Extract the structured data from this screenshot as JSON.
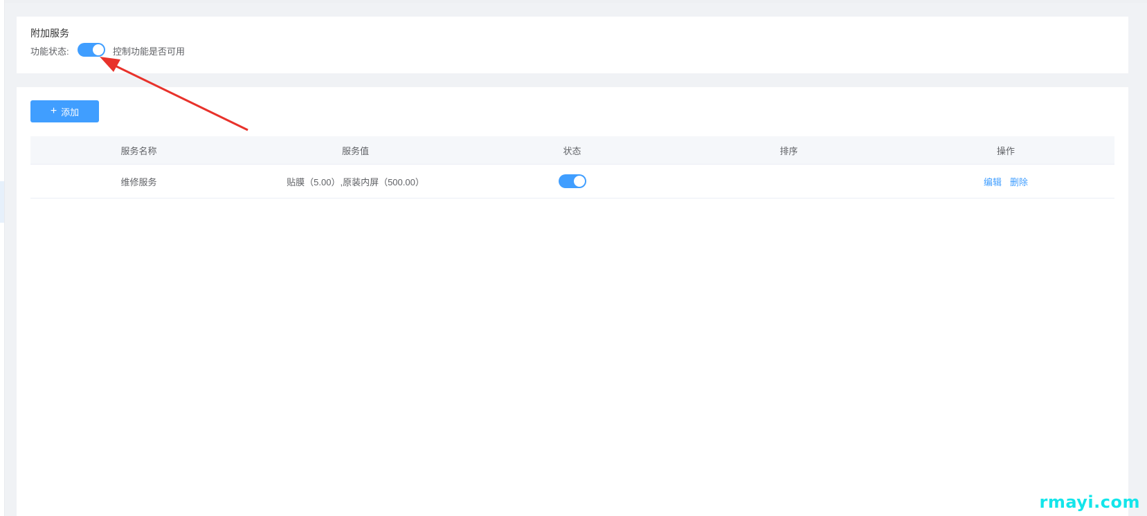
{
  "header": {
    "title": "附加服务",
    "status_label": "功能状态:",
    "status_enabled": true,
    "status_description": "控制功能是否可用"
  },
  "toolbar": {
    "add_label": "添加",
    "add_icon": "plus-icon"
  },
  "table": {
    "columns": [
      "服务名称",
      "服务值",
      "状态",
      "排序",
      "操作"
    ],
    "rows": [
      {
        "name": "维修服务",
        "value": "贴膜（5.00）,原装内屏（500.00）",
        "enabled": true,
        "sort": "",
        "actions": [
          "编辑",
          "删除"
        ]
      }
    ]
  },
  "colors": {
    "accent": "#409eff",
    "annotation_arrow": "#e8322b"
  },
  "watermark": "rmayi.com"
}
